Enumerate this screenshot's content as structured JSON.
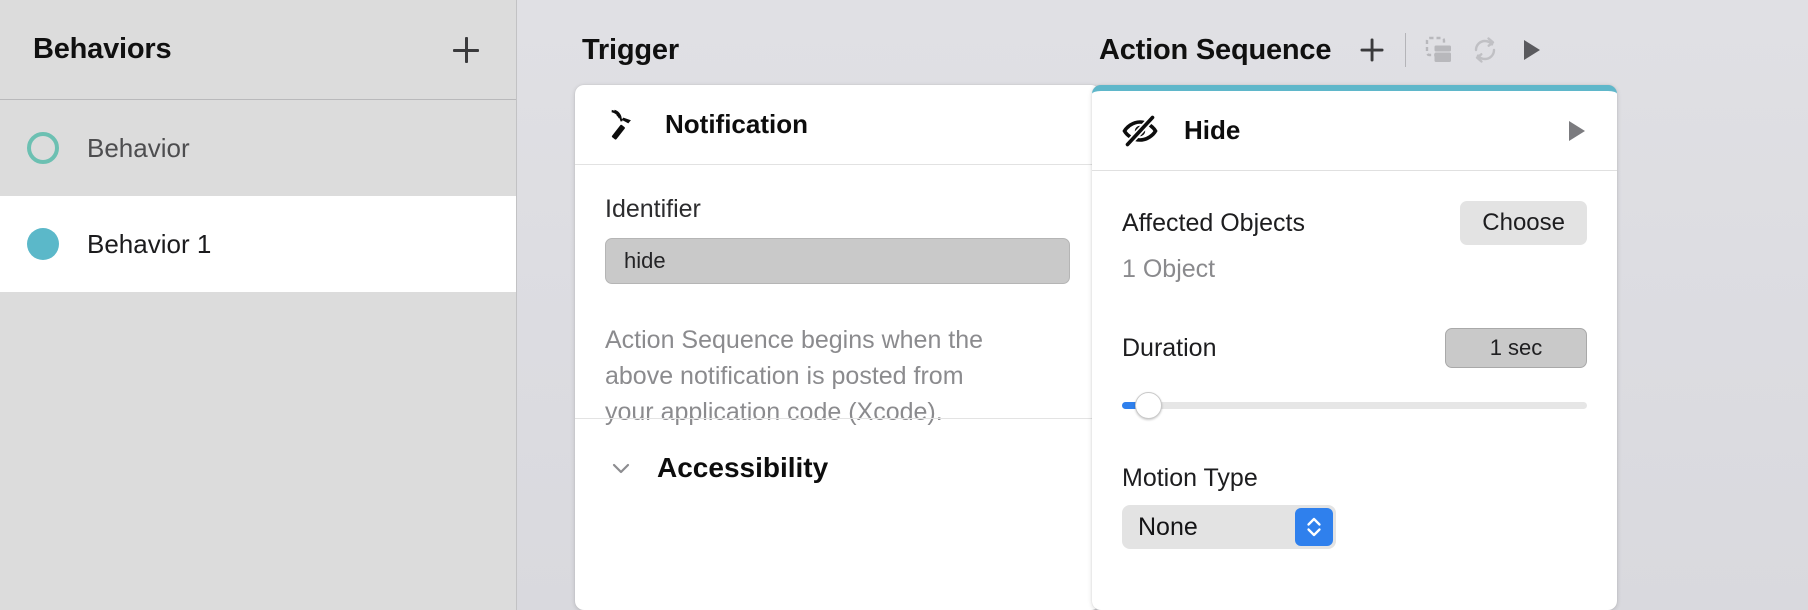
{
  "sidebar": {
    "title": "Behaviors",
    "add_icon": "plus-icon",
    "items": [
      {
        "label": "Behavior",
        "selected": false,
        "dot": "hollow",
        "dot_color": "#6cc0b2"
      },
      {
        "label": "Behavior 1",
        "selected": true,
        "dot": "filled",
        "dot_color": "#5bb8c9"
      }
    ]
  },
  "trigger": {
    "column_title": "Trigger",
    "card": {
      "icon": "notification-hammer-icon",
      "title": "Notification",
      "identifier_label": "Identifier",
      "identifier_value": "hide",
      "identifier_placeholder": "Identifier",
      "hint": "Action Sequence begins when the above notification is posted from your application code (Xcode).",
      "accessibility_section": {
        "title": "Accessibility",
        "chevron": "chevron-down-icon",
        "expanded": false
      }
    }
  },
  "action_sequence": {
    "column_title": "Action Sequence",
    "toolbar": [
      {
        "name": "add-action-icon",
        "glyph": "plus-icon",
        "enabled": true
      },
      {
        "name": "duplicate-action-icon",
        "glyph": "duplicate-icon",
        "enabled": false
      },
      {
        "name": "loop-action-icon",
        "glyph": "loop-icon",
        "enabled": false
      },
      {
        "name": "play-sequence-icon",
        "glyph": "play-icon",
        "enabled": true
      }
    ],
    "card": {
      "accent_color": "#5fb7ca",
      "icon": "eye-slash-icon",
      "title": "Hide",
      "play_icon": "play-icon",
      "affected_objects_label": "Affected Objects",
      "choose_button": "Choose",
      "affected_objects_value": "1 Object",
      "duration_label": "Duration",
      "duration_value": "1 sec",
      "duration_slider_percent": 2,
      "motion_type_label": "Motion Type",
      "motion_type_value": "None",
      "motion_type_options": [
        "None"
      ]
    }
  },
  "colors": {
    "accent_teal": "#5fb7ca",
    "accent_green": "#6cc0b2",
    "system_blue": "#2f80ed",
    "canvas": "#dcdce1",
    "sidebar": "#dcdcdc"
  }
}
